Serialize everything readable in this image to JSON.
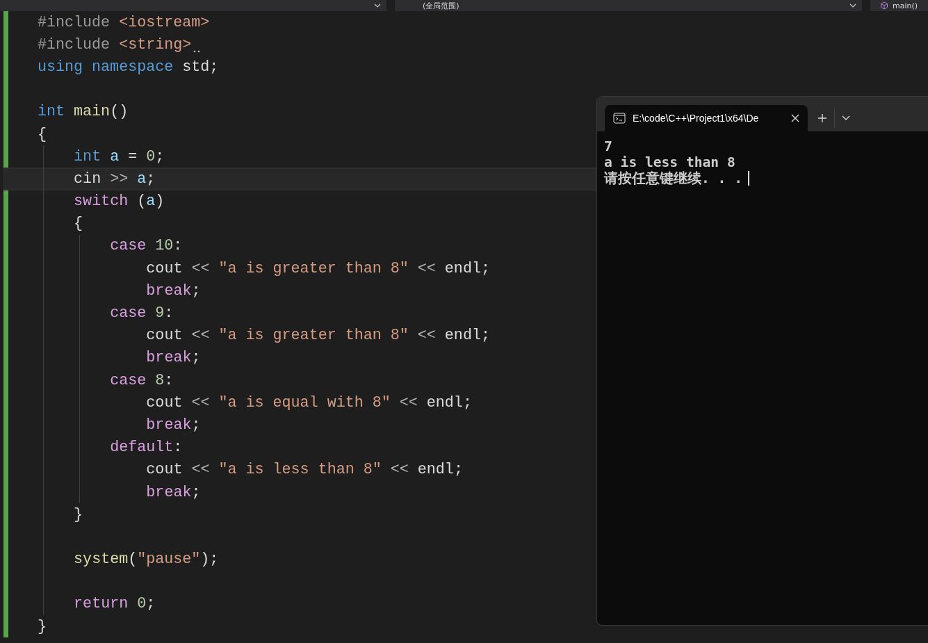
{
  "navigation_bar": {
    "scope": "(全局范围)",
    "member": "main()"
  },
  "editor": {
    "lines": [
      {
        "kind": "code",
        "current": false,
        "hint": false,
        "tokens": [
          {
            "text": "#include",
            "kind": "macro"
          },
          {
            "text": " <iostream>",
            "kind": "string"
          }
        ]
      },
      {
        "kind": "code",
        "current": false,
        "hint": true,
        "tokens": [
          {
            "text": "#include",
            "kind": "macro"
          },
          {
            "text": " <string>",
            "kind": "string"
          }
        ]
      },
      {
        "kind": "code",
        "current": false,
        "hint": false,
        "tokens": [
          {
            "text": "using namespace",
            "kind": "keyword"
          },
          {
            "text": " std;",
            "kind": "plain"
          }
        ]
      },
      {
        "kind": "blank",
        "current": false
      },
      {
        "kind": "code",
        "current": false,
        "hint": false,
        "tokens": [
          {
            "text": "int",
            "kind": "keyword"
          },
          {
            "text": " main",
            "kind": "function"
          },
          {
            "text": "()",
            "kind": "plain"
          }
        ]
      },
      {
        "kind": "code",
        "current": false,
        "hint": false,
        "tokens": [
          {
            "text": "{",
            "kind": "plain"
          }
        ]
      },
      {
        "kind": "code",
        "current": false,
        "hint": false,
        "tokens": [
          {
            "text": "    int",
            "kind": "keyword"
          },
          {
            "text": " a",
            "kind": "variable"
          },
          {
            "text": " = ",
            "kind": "plain"
          },
          {
            "text": "0",
            "kind": "number"
          },
          {
            "text": ";",
            "kind": "plain"
          }
        ]
      },
      {
        "kind": "code",
        "current": true,
        "hint": false,
        "tokens": [
          {
            "text": "    cin",
            "kind": "plain"
          },
          {
            "text": " >> ",
            "kind": "operator"
          },
          {
            "text": "a",
            "kind": "variable"
          },
          {
            "text": ";",
            "kind": "plain"
          }
        ]
      },
      {
        "kind": "code",
        "current": false,
        "hint": false,
        "tokens": [
          {
            "text": "    switch",
            "kind": "control"
          },
          {
            "text": " (",
            "kind": "plain"
          },
          {
            "text": "a",
            "kind": "variable"
          },
          {
            "text": ")",
            "kind": "plain"
          }
        ]
      },
      {
        "kind": "code",
        "current": false,
        "hint": false,
        "tokens": [
          {
            "text": "    {",
            "kind": "plain"
          }
        ]
      },
      {
        "kind": "code",
        "current": false,
        "hint": false,
        "tokens": [
          {
            "text": "        case",
            "kind": "control"
          },
          {
            "text": " 10",
            "kind": "number"
          },
          {
            "text": ":",
            "kind": "plain"
          }
        ]
      },
      {
        "kind": "code",
        "current": false,
        "hint": false,
        "tokens": [
          {
            "text": "            cout",
            "kind": "plain"
          },
          {
            "text": " << ",
            "kind": "operator"
          },
          {
            "text": "\"a is greater than 8\"",
            "kind": "string"
          },
          {
            "text": " << ",
            "kind": "operator"
          },
          {
            "text": "endl",
            "kind": "plain"
          },
          {
            "text": ";",
            "kind": "plain"
          }
        ]
      },
      {
        "kind": "code",
        "current": false,
        "hint": false,
        "tokens": [
          {
            "text": "            break",
            "kind": "control"
          },
          {
            "text": ";",
            "kind": "plain"
          }
        ]
      },
      {
        "kind": "code",
        "current": false,
        "hint": false,
        "tokens": [
          {
            "text": "        case",
            "kind": "control"
          },
          {
            "text": " 9",
            "kind": "number"
          },
          {
            "text": ":",
            "kind": "plain"
          }
        ]
      },
      {
        "kind": "code",
        "current": false,
        "hint": false,
        "tokens": [
          {
            "text": "            cout",
            "kind": "plain"
          },
          {
            "text": " << ",
            "kind": "operator"
          },
          {
            "text": "\"a is greater than 8\"",
            "kind": "string"
          },
          {
            "text": " << ",
            "kind": "operator"
          },
          {
            "text": "endl",
            "kind": "plain"
          },
          {
            "text": ";",
            "kind": "plain"
          }
        ]
      },
      {
        "kind": "code",
        "current": false,
        "hint": false,
        "tokens": [
          {
            "text": "            break",
            "kind": "control"
          },
          {
            "text": ";",
            "kind": "plain"
          }
        ]
      },
      {
        "kind": "code",
        "current": false,
        "hint": false,
        "tokens": [
          {
            "text": "        case",
            "kind": "control"
          },
          {
            "text": " 8",
            "kind": "number"
          },
          {
            "text": ":",
            "kind": "plain"
          }
        ]
      },
      {
        "kind": "code",
        "current": false,
        "hint": false,
        "tokens": [
          {
            "text": "            cout",
            "kind": "plain"
          },
          {
            "text": " << ",
            "kind": "operator"
          },
          {
            "text": "\"a is equal with 8\"",
            "kind": "string"
          },
          {
            "text": " << ",
            "kind": "operator"
          },
          {
            "text": "endl",
            "kind": "plain"
          },
          {
            "text": ";",
            "kind": "plain"
          }
        ]
      },
      {
        "kind": "code",
        "current": false,
        "hint": false,
        "tokens": [
          {
            "text": "            break",
            "kind": "control"
          },
          {
            "text": ";",
            "kind": "plain"
          }
        ]
      },
      {
        "kind": "code",
        "current": false,
        "hint": false,
        "tokens": [
          {
            "text": "        default",
            "kind": "control"
          },
          {
            "text": ":",
            "kind": "plain"
          }
        ]
      },
      {
        "kind": "code",
        "current": false,
        "hint": false,
        "tokens": [
          {
            "text": "            cout",
            "kind": "plain"
          },
          {
            "text": " << ",
            "kind": "operator"
          },
          {
            "text": "\"a is less than 8\"",
            "kind": "string"
          },
          {
            "text": " << ",
            "kind": "operator"
          },
          {
            "text": "endl",
            "kind": "plain"
          },
          {
            "text": ";",
            "kind": "plain"
          }
        ]
      },
      {
        "kind": "code",
        "current": false,
        "hint": false,
        "tokens": [
          {
            "text": "            break",
            "kind": "control"
          },
          {
            "text": ";",
            "kind": "plain"
          }
        ]
      },
      {
        "kind": "code",
        "current": false,
        "hint": false,
        "tokens": [
          {
            "text": "    }",
            "kind": "plain"
          }
        ]
      },
      {
        "kind": "blank",
        "current": false
      },
      {
        "kind": "code",
        "current": false,
        "hint": false,
        "tokens": [
          {
            "text": "    system",
            "kind": "function"
          },
          {
            "text": "(",
            "kind": "plain"
          },
          {
            "text": "\"pause\"",
            "kind": "string"
          },
          {
            "text": ");",
            "kind": "plain"
          }
        ]
      },
      {
        "kind": "blank",
        "current": false
      },
      {
        "kind": "code",
        "current": false,
        "hint": false,
        "tokens": [
          {
            "text": "    return",
            "kind": "control"
          },
          {
            "text": " 0",
            "kind": "number"
          },
          {
            "text": ";",
            "kind": "plain"
          }
        ]
      },
      {
        "kind": "code",
        "current": false,
        "hint": false,
        "tokens": [
          {
            "text": "}",
            "kind": "plain"
          }
        ]
      }
    ]
  },
  "terminal": {
    "tab_title": "E:\\code\\C++\\Project1\\x64\\De",
    "output": [
      "7",
      "a is less than 8",
      "请按任意键继续. . ."
    ]
  }
}
